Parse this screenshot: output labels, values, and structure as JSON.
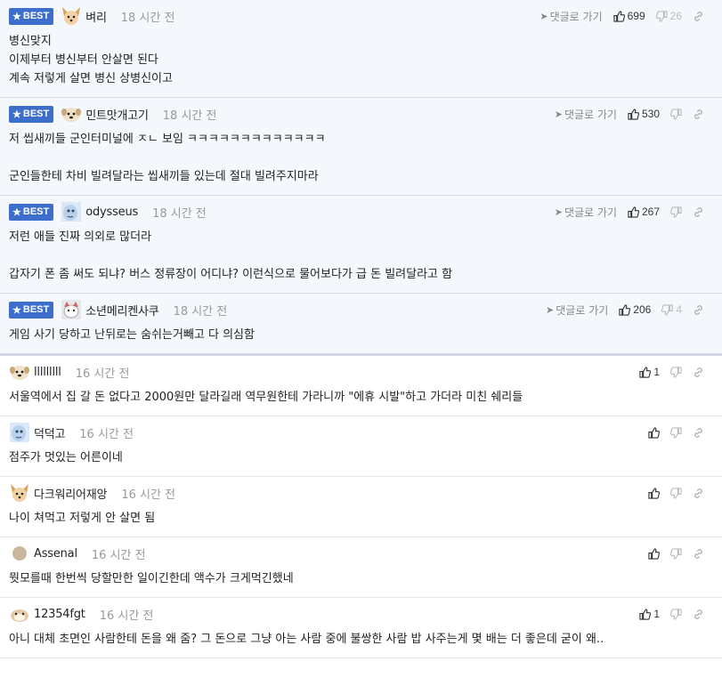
{
  "labels": {
    "best": "BEST",
    "reply": "댓글로 가기"
  },
  "colors": {
    "best_badge": "#3d6ecc",
    "best_bg": "#f4f7fc"
  },
  "comments": [
    {
      "best": true,
      "avatar": "fox-icon",
      "nick": "벼리",
      "time": "18 시간 전",
      "reply": true,
      "up": "699",
      "down": "26",
      "lines": [
        "병신맞지",
        "이제부터 병신부터 안살면 된다",
        "계속 저렇게 살면 병신 상병신이고"
      ]
    },
    {
      "best": true,
      "avatar": "dog-icon",
      "nick": "민트맛개고기",
      "time": "18 시간 전",
      "reply": true,
      "up": "530",
      "down": "",
      "lines": [
        "저 씹새끼들 군인터미널에 ㅈㄴ 보임 ㅋㅋㅋㅋㅋㅋㅋㅋㅋㅋㅋㅋㅋ",
        "",
        "군인들한테 차비 빌려달라는 씹새끼들 있는데 절대 빌려주지마라"
      ]
    },
    {
      "best": true,
      "avatar": "blue-creature-icon",
      "nick": "odysseus",
      "time": "18 시간 전",
      "reply": true,
      "up": "267",
      "down": "",
      "lines": [
        "저런 애들 진짜 의외로 많더라",
        "",
        "갑자기 폰 좀 써도 되냐? 버스 정류장이 어디냐? 이런식으로 물어보다가 급 돈 빌려달라고 함"
      ]
    },
    {
      "best": true,
      "avatar": "cat-icon",
      "nick": "소년메리켄사쿠",
      "time": "18 시간 전",
      "reply": true,
      "up": "206",
      "down": "4",
      "lines": [
        "게임 사기 당하고 난뒤로는 숨쉬는거빼고 다 의심함"
      ]
    },
    {
      "best": false,
      "avatar": "dog-icon",
      "nick": "lllllllll",
      "time": "16 시간 전",
      "reply": false,
      "up": "1",
      "down": "",
      "lines": [
        "서울역에서 집 갈 돈 없다고 2000원만 달라길래 역무원한테 가라니까 \"에휴 시발\"하고 가더라 미친 쉐리들"
      ]
    },
    {
      "best": false,
      "avatar": "blue-creature-icon",
      "nick": "덕덕고",
      "time": "16 시간 전",
      "reply": false,
      "up": "",
      "down": "",
      "lines": [
        "점주가 멋있는 어른이네"
      ]
    },
    {
      "best": false,
      "avatar": "fox-icon",
      "nick": "다크워리어재앙",
      "time": "16 시간 전",
      "reply": false,
      "up": "",
      "down": "",
      "lines": [
        "나이 쳐먹고 저렇게 안 살면 됨"
      ]
    },
    {
      "best": false,
      "avatar": "circle-icon",
      "nick": "Assenal",
      "time": "16 시간 전",
      "reply": false,
      "up": "",
      "down": "",
      "lines": [
        "뭣모를때 한번씩 당할만한 일이긴한데 액수가 크게먹긴했네"
      ]
    },
    {
      "best": false,
      "avatar": "hamster-icon",
      "nick": "12354fgt",
      "time": "16 시간 전",
      "reply": false,
      "up": "1",
      "down": "",
      "lines": [
        "아니 대체 초면인 사람한테 돈을 왜 줌? 그 돈으로 그냥 아는 사람 중에 불쌍한 사람 밥 사주는게 몇 배는 더 좋은데 굳이 왜.."
      ]
    }
  ]
}
